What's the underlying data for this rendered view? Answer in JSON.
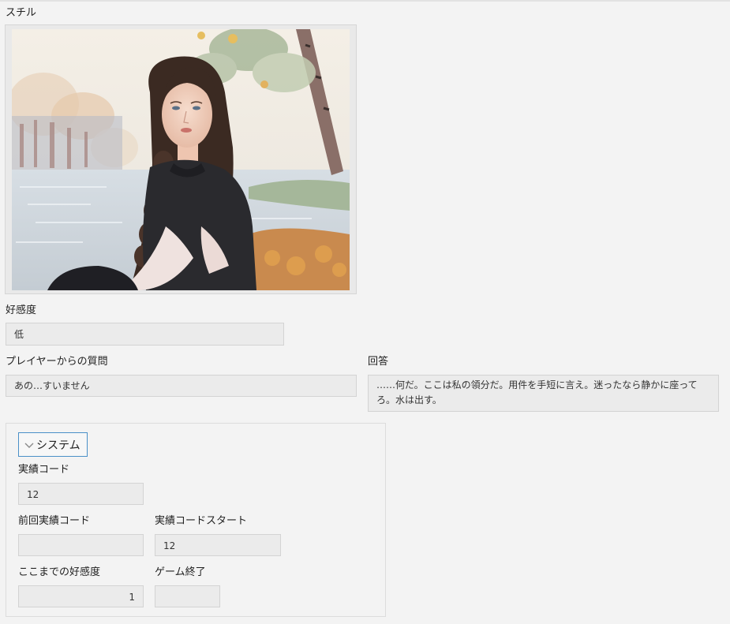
{
  "still": {
    "label": "スチル"
  },
  "affinity": {
    "label": "好感度",
    "value": "低"
  },
  "question": {
    "label": "プレイヤーからの質問",
    "value": "あの…すいません"
  },
  "answer": {
    "label": "回答",
    "value": "……何だ。ここは私の領分だ。用件を手短に言え。迷ったなら静かに座ってろ。水は出す。"
  },
  "system": {
    "toggle_label": "システム",
    "achievement_code": {
      "label": "実績コード",
      "value": "12"
    },
    "prev_achievement_code": {
      "label": "前回実績コード",
      "value": ""
    },
    "achievement_code_start": {
      "label": "実績コードスタート",
      "value": "12"
    },
    "affinity_so_far": {
      "label": "ここまでの好感度",
      "value": "1"
    },
    "game_over": {
      "label": "ゲーム終了",
      "value": ""
    }
  },
  "colors": {
    "background": "#f3f3f3",
    "field_bg": "#ebebeb",
    "field_border": "#d3d3d3",
    "toggle_border": "#4a90c8"
  }
}
